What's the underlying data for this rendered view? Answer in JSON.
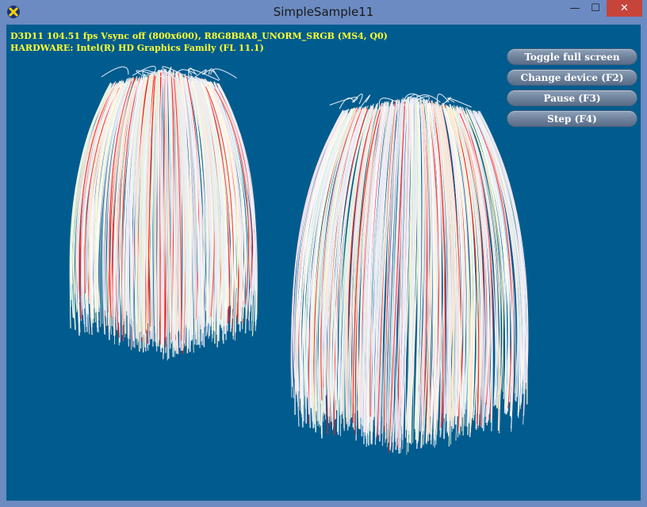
{
  "window": {
    "title": "SimpleSample11",
    "minimize_glyph": "—",
    "maximize_glyph": "☐",
    "close_glyph": "✕",
    "app_icon": "dx-sample-icon"
  },
  "hud": {
    "stats_line1": "D3D11 104.51 fps Vsync off (800x600), R8G8B8A8_UNORM_SRGB (MS4, Q0)",
    "stats_line2": "HARDWARE: Intel(R) HD Graphics Family (FL 11.1)",
    "stats_color": "#ffff33"
  },
  "buttons": [
    {
      "label": "Toggle full screen"
    },
    {
      "label": "Change device (F2)"
    },
    {
      "label": "Pause (F3)"
    },
    {
      "label": "Step (F4)"
    }
  ],
  "scene": {
    "background": "#005c8e",
    "strand_colors": [
      "#ffffff",
      "#f3e6ea",
      "#ffe9c9",
      "#e8f2ff",
      "#dff7df",
      "#fde0ee",
      "#ffffd6",
      "#e6f0ff",
      "#f9f4ff"
    ],
    "accent_strand_color": "#ff1a1a"
  }
}
